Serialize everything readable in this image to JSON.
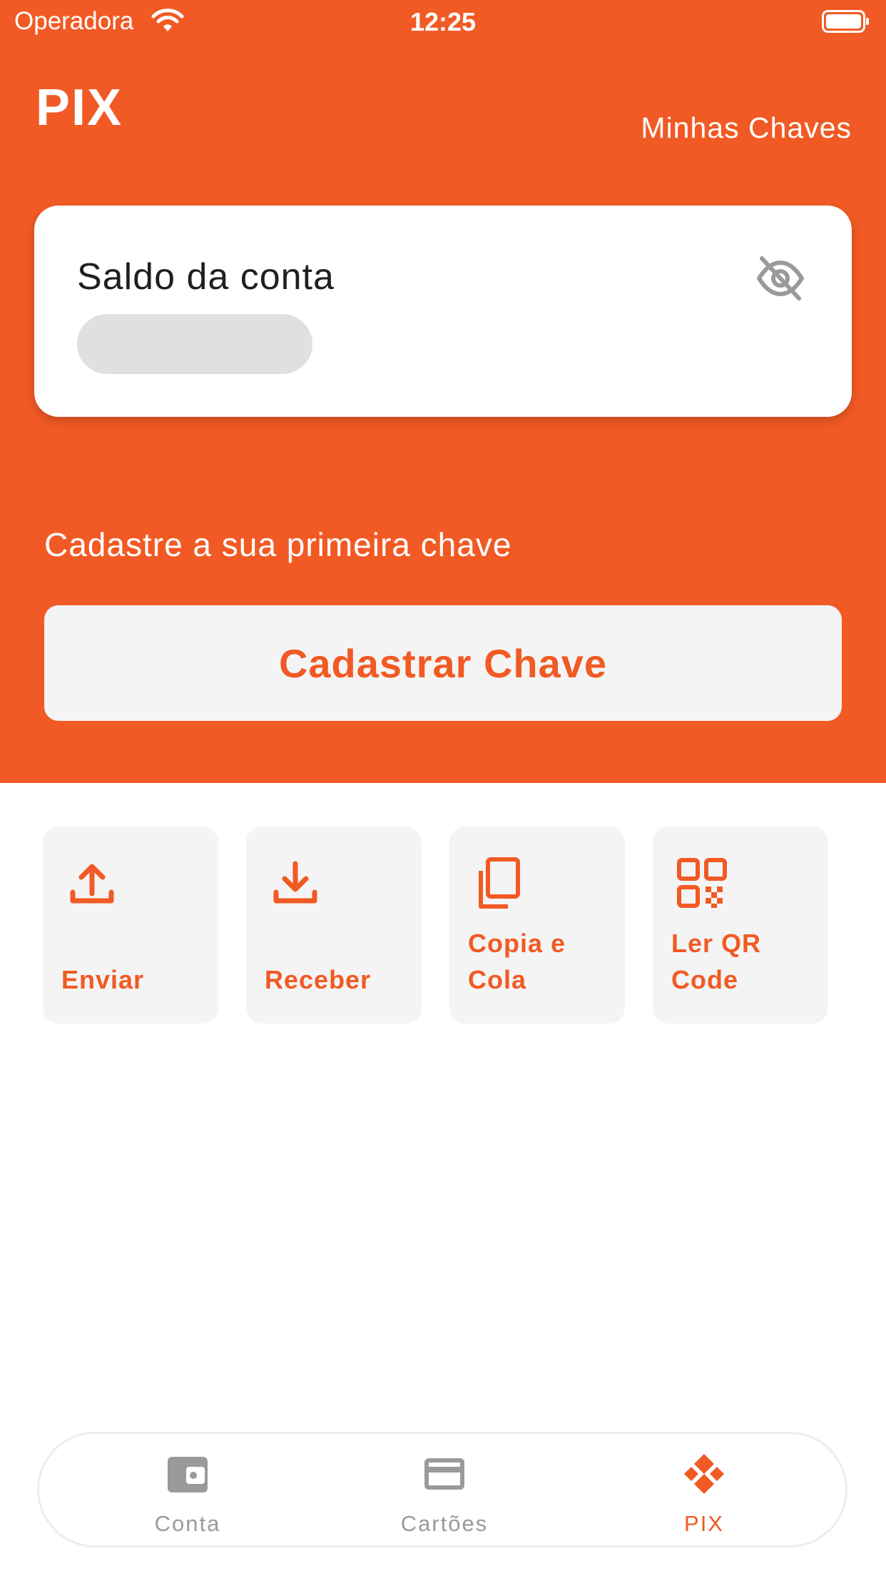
{
  "colors": {
    "accent": "#f15a24",
    "card": "#f4f4f4",
    "muted": "#9a9a9a"
  },
  "status_bar": {
    "carrier": "Operadora",
    "time": "12:25"
  },
  "header": {
    "title": "PIX",
    "my_keys_link": "Minhas Chaves"
  },
  "balance_card": {
    "label": "Saldo da conta",
    "toggle_icon": "eye-off-icon"
  },
  "register": {
    "hint": "Cadastre a sua primeira chave",
    "button_label": "Cadastrar Chave"
  },
  "actions": [
    {
      "label": "Enviar",
      "icon": "upload-icon"
    },
    {
      "label": "Receber",
      "icon": "download-icon"
    },
    {
      "label": "Copia e Cola",
      "icon": "copy-icon"
    },
    {
      "label": "Ler QR Code",
      "icon": "qr-code-icon"
    }
  ],
  "tabbar": {
    "items": [
      {
        "label": "Conta",
        "icon": "wallet-icon",
        "active": false
      },
      {
        "label": "Cartões",
        "icon": "card-icon",
        "active": false
      },
      {
        "label": "PIX",
        "icon": "pix-icon",
        "active": true
      }
    ]
  }
}
